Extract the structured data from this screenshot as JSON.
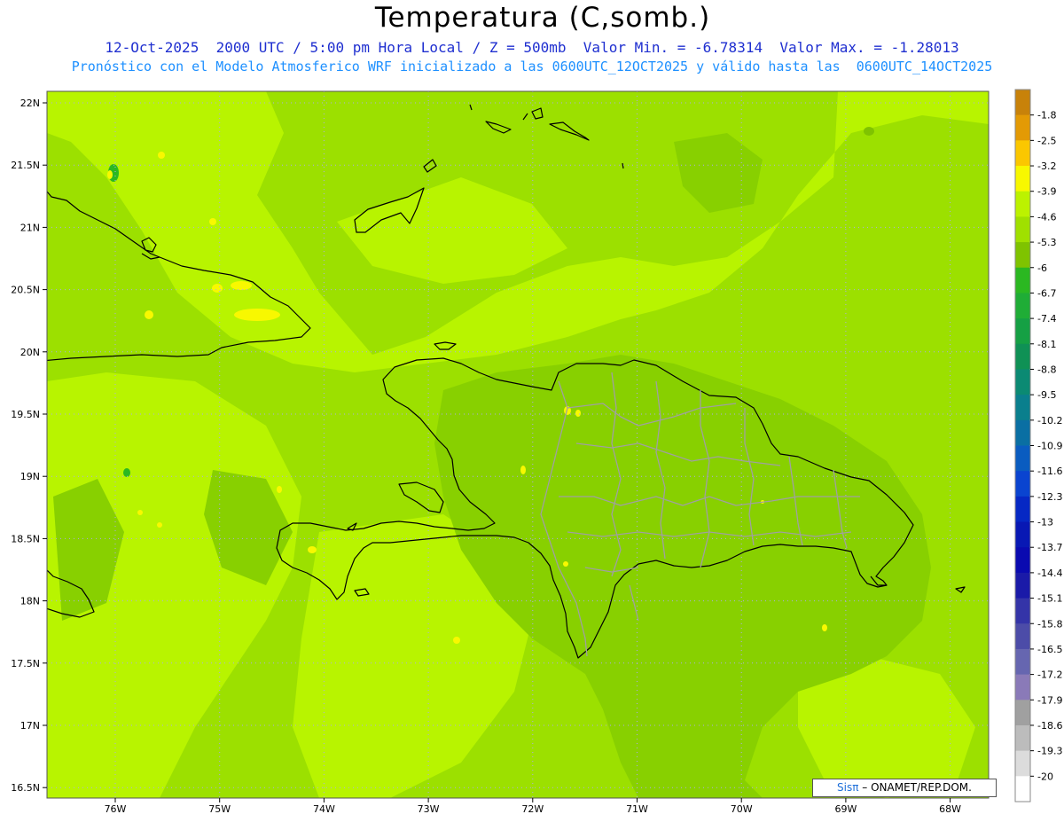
{
  "header": {
    "title": "Temperatura (C,somb.)",
    "line1": "12-Oct-2025  2000 UTC / 5:00 pm Hora Local / Z = 500mb  Valor Min. = -6.78314  Valor Max. = -1.28013",
    "line2": "Pronóstico con el Modelo Atmosferico WRF inicializado a las 0600UTC_12OCT2025 y válido hasta las  0600UTC_14OCT2025"
  },
  "axes": {
    "lat_labels": [
      "22N",
      "21.5N",
      "21N",
      "20.5N",
      "20N",
      "19.5N",
      "19N",
      "18.5N",
      "18N",
      "17.5N",
      "17N",
      "16.5N"
    ],
    "lon_labels": [
      "76W",
      "75W",
      "74W",
      "73W",
      "72W",
      "71W",
      "70W",
      "69W",
      "68W"
    ]
  },
  "colorbar": {
    "labels": [
      "-1.8",
      "-2.5",
      "-3.2",
      "-3.9",
      "-4.6",
      "-5.3",
      "-6",
      "-6.7",
      "-7.4",
      "-8.1",
      "-8.8",
      "-9.5",
      "-10.2",
      "-10.9",
      "-11.6",
      "-12.3",
      "-13",
      "-13.7",
      "-14.4",
      "-15.1",
      "-15.8",
      "-16.5",
      "-17.2",
      "-17.9",
      "-18.6",
      "-19.3",
      "-20"
    ],
    "colors": [
      "#c8820a",
      "#e39a05",
      "#fbc700",
      "#f8f800",
      "#bcf200",
      "#a0e000",
      "#7fc300",
      "#2bb821",
      "#1fad36",
      "#15a044",
      "#0f9155",
      "#0b8a73",
      "#0a7f8d",
      "#0a6fa3",
      "#0a5cc0",
      "#0a44d0",
      "#0628c4",
      "#0818b4",
      "#0a0ab0",
      "#1a1aa8",
      "#3434a8",
      "#4c4ca8",
      "#6666b0",
      "#8a7ab8",
      "#a0a0a0",
      "#bcbcbc",
      "#dcdcdc",
      "#ffffff"
    ]
  },
  "colors": {
    "background_field": "#9ce000",
    "dark_field": "#88d000",
    "light_field": "#b8f400",
    "coastline": "#000000",
    "provinces": "#a0a0a0",
    "subtitle1": "#1f2fd0",
    "subtitle2": "#1e90ff"
  },
  "credit": {
    "sis": "Sisπ",
    "rest": " – ONAMET/REP.DOM."
  }
}
